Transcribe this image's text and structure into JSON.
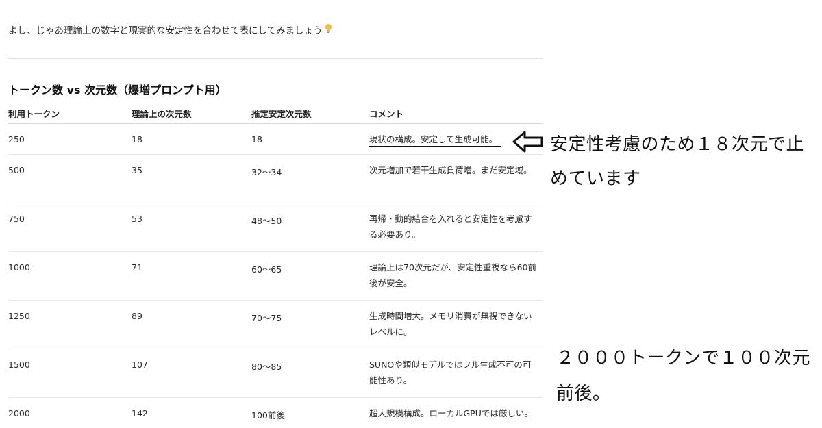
{
  "intro": {
    "text": "よし、じゃあ理論上の数字と現実的な安定性を合わせて表にしてみましょう",
    "icon": "lightbulb-icon"
  },
  "section": {
    "title": "トークン数 vs 次元数（爆増プロンプト用）"
  },
  "table": {
    "headers": [
      "利用トークン",
      "理論上の次元数",
      "推定安定次元数",
      "コメント"
    ],
    "rows": [
      [
        "250",
        "18",
        "18",
        "現状の構成。安定して生成可能。"
      ],
      [
        "500",
        "35",
        "32〜34",
        "次元増加で若干生成負荷増。まだ安定域。"
      ],
      [
        "750",
        "53",
        "48〜50",
        "再帰・動的結合を入れると安定性を考慮する必要あり。"
      ],
      [
        "1000",
        "71",
        "60〜65",
        "理論上は70次元だが、安定性重視なら60前後が安全。"
      ],
      [
        "1250",
        "89",
        "70〜75",
        "生成時間増大。メモリ消費が無視できないレベルに。"
      ],
      [
        "1500",
        "107",
        "80〜85",
        "SUNOや類似モデルではフル生成不可の可能性あり。"
      ],
      [
        "2000",
        "142",
        "100前後",
        "超大規模構成。ローカルGPUでは厳しい。"
      ]
    ]
  },
  "annotations": {
    "arrow_icon": "arrow-left-icon",
    "note1": "安定性考慮のため１８次元で止めています",
    "note2": "２０００トークンで１００次元前後。"
  }
}
